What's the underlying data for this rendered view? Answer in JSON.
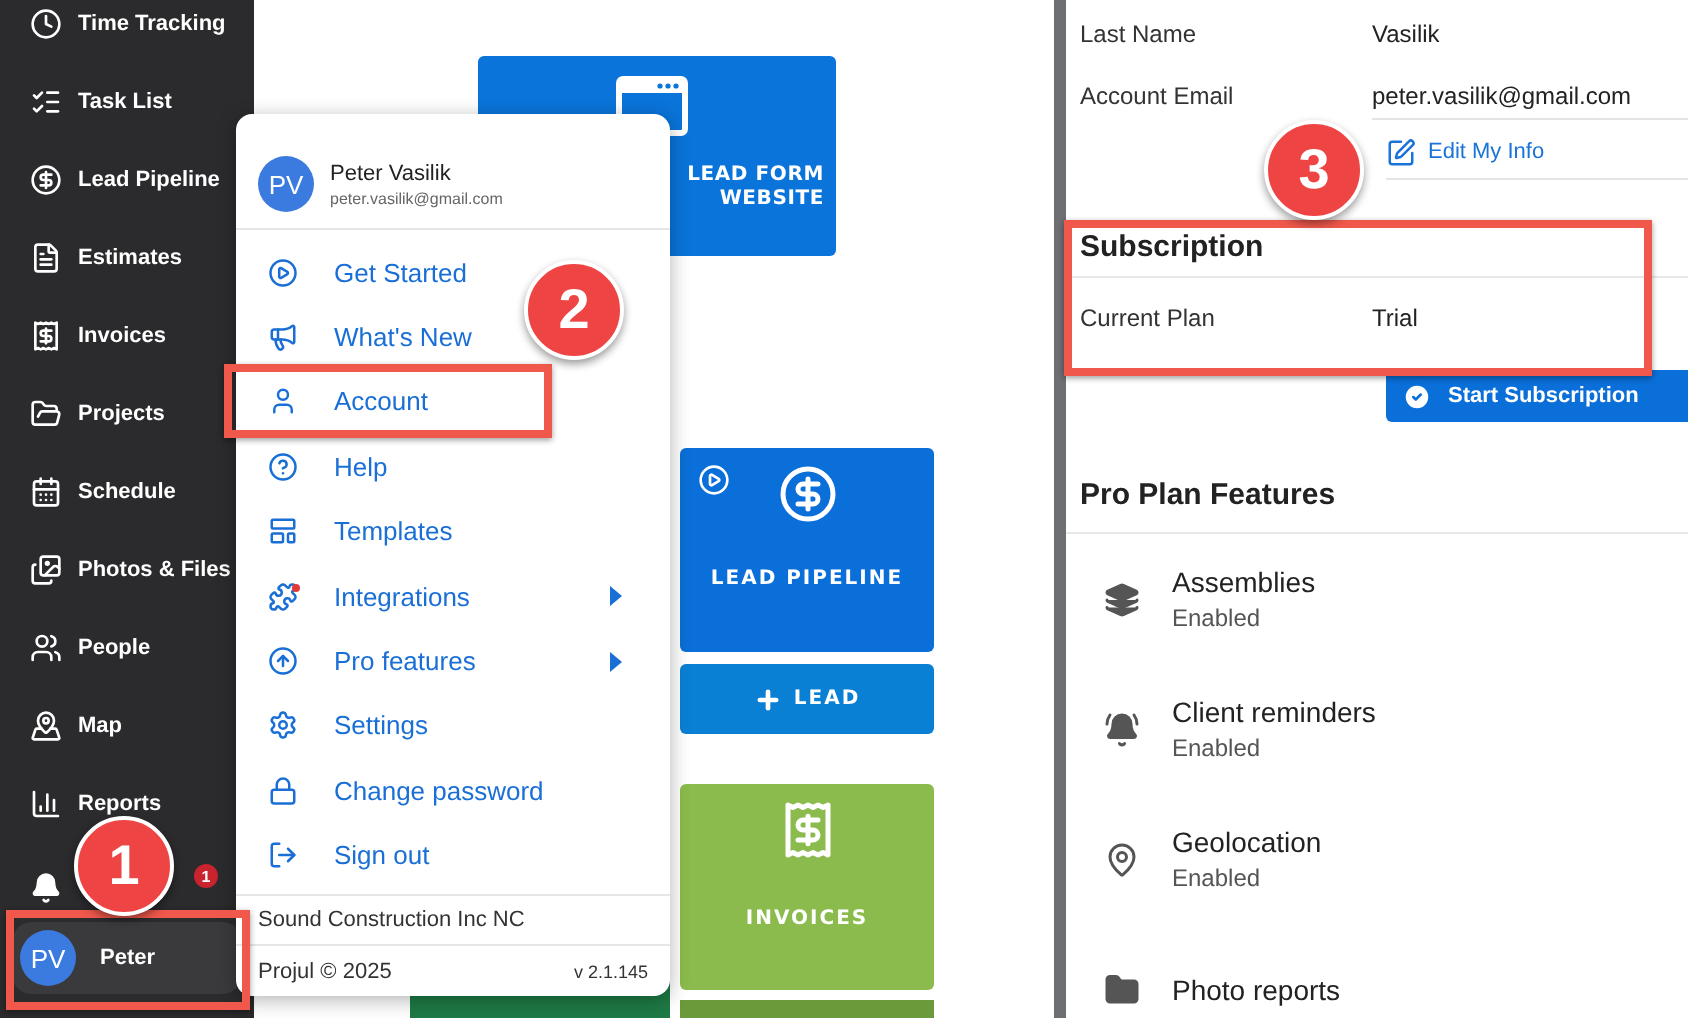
{
  "sidebar": {
    "items": [
      {
        "label": "Time Tracking"
      },
      {
        "label": "Task List"
      },
      {
        "label": "Lead Pipeline"
      },
      {
        "label": "Estimates"
      },
      {
        "label": "Invoices"
      },
      {
        "label": "Projects"
      },
      {
        "label": "Schedule"
      },
      {
        "label": "Photos & Files"
      },
      {
        "label": "People"
      },
      {
        "label": "Map"
      },
      {
        "label": "Reports"
      }
    ],
    "alerts_count": "1",
    "user": {
      "initials": "PV",
      "name": "Peter"
    }
  },
  "tiles": [
    {
      "kind": "website",
      "lines": [
        "LEAD FORM",
        "WEBSITE"
      ],
      "color": "#0a74da"
    },
    {
      "kind": "pipeline",
      "lines": [
        "LEAD PIPELINE"
      ],
      "color": "#0a6fd8"
    },
    {
      "kind": "add",
      "lines": [
        "LEAD"
      ],
      "color": "#0a80d4"
    },
    {
      "kind": "invoices",
      "lines": [
        "INVOICES"
      ],
      "color": "#8bbb4c"
    }
  ],
  "user_menu": {
    "initials": "PV",
    "name": "Peter Vasilik",
    "email": "peter.vasilik@gmail.com",
    "items": [
      {
        "label": "Get Started",
        "submenu": false,
        "alert": false
      },
      {
        "label": "What's New",
        "submenu": false,
        "alert": false
      },
      {
        "label": "Account",
        "submenu": false,
        "alert": false
      },
      {
        "label": "Help",
        "submenu": false,
        "alert": false
      },
      {
        "label": "Templates",
        "submenu": false,
        "alert": false
      },
      {
        "label": "Integrations",
        "submenu": true,
        "alert": true
      },
      {
        "label": "Pro features",
        "submenu": true,
        "alert": false
      },
      {
        "label": "Settings",
        "submenu": false,
        "alert": false
      },
      {
        "label": "Change password",
        "submenu": false,
        "alert": false
      },
      {
        "label": "Sign out",
        "submenu": false,
        "alert": false
      }
    ],
    "company": "Sound Construction Inc NC",
    "copyright": "Projul © 2025",
    "version": "v 2.1.145"
  },
  "account": {
    "fields": [
      {
        "label": "Last Name",
        "value": "Vasilik"
      },
      {
        "label": "Account Email",
        "value": "peter.vasilik@gmail.com"
      }
    ],
    "edit_link": "Edit My Info",
    "subscription": {
      "title": "Subscription",
      "label": "Current Plan",
      "value": "Trial",
      "button": "Start Subscription"
    },
    "features_title": "Pro Plan Features",
    "features": [
      {
        "name": "Assemblies",
        "status": "Enabled"
      },
      {
        "name": "Client reminders",
        "status": "Enabled"
      },
      {
        "name": "Geolocation",
        "status": "Enabled"
      },
      {
        "name": "Photo reports"
      }
    ]
  },
  "annotations": [
    {
      "number": "1"
    },
    {
      "number": "2"
    },
    {
      "number": "3"
    }
  ]
}
